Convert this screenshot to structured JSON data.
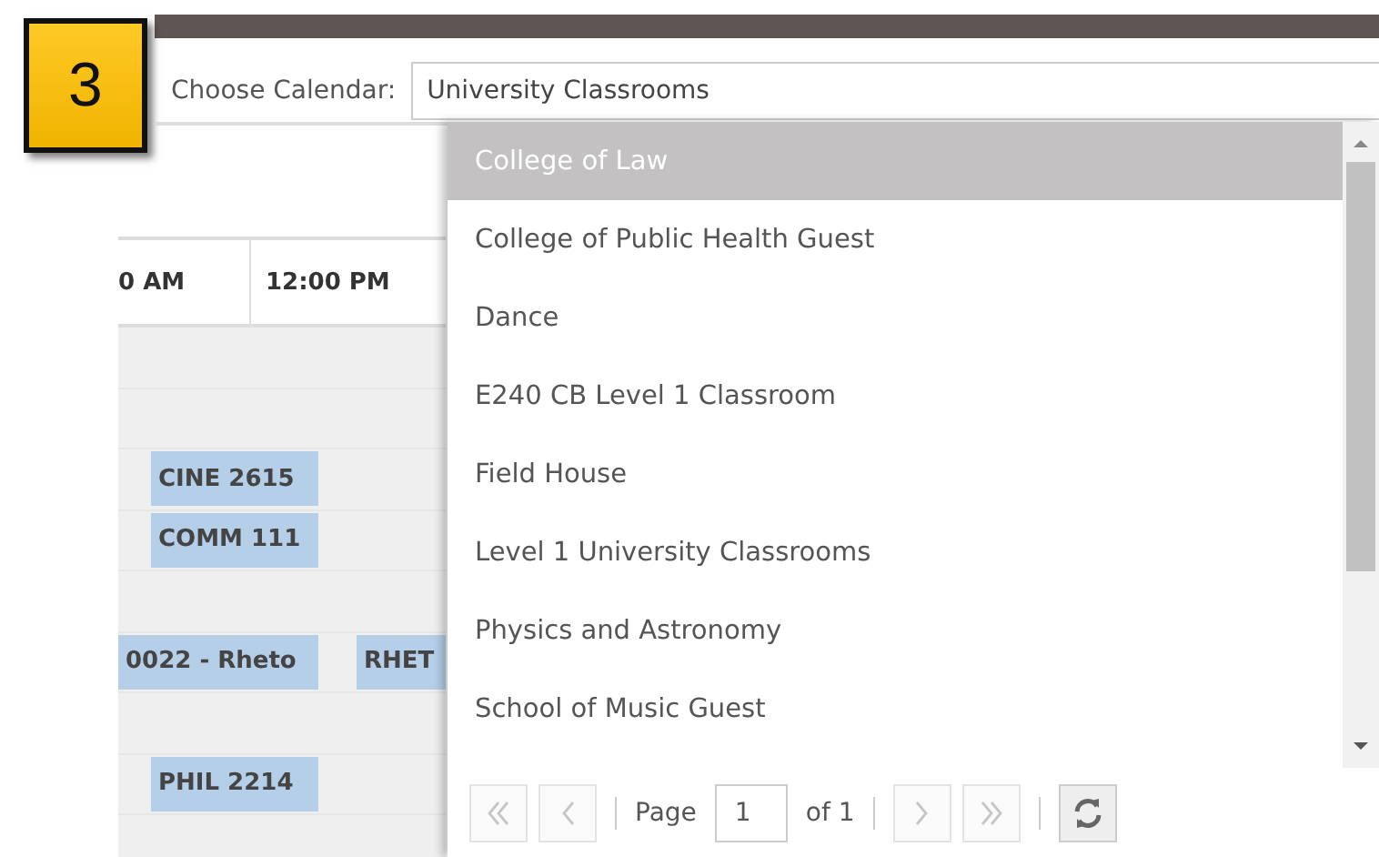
{
  "step_badge": "3",
  "calendar_picker": {
    "label": "Choose Calendar:",
    "value": "University Classrooms"
  },
  "dropdown": {
    "items": [
      {
        "label": "College of Law",
        "selected": true
      },
      {
        "label": "College of Public Health Guest",
        "selected": false
      },
      {
        "label": "Dance",
        "selected": false
      },
      {
        "label": "E240 CB Level 1 Classroom",
        "selected": false
      },
      {
        "label": "Field House",
        "selected": false
      },
      {
        "label": "Level 1 University Classrooms",
        "selected": false
      },
      {
        "label": "Physics and Astronomy",
        "selected": false
      },
      {
        "label": "School of Music Guest",
        "selected": false
      }
    ],
    "pager": {
      "buttons": [
        {
          "kind": "first",
          "disabled": true
        },
        {
          "kind": "prev",
          "disabled": true
        },
        {
          "kind": "next",
          "disabled": true
        },
        {
          "kind": "last",
          "disabled": true
        },
        {
          "kind": "refresh",
          "disabled": false
        }
      ],
      "label": "Page",
      "page": "1",
      "total": "of 1"
    }
  },
  "calendar": {
    "columns": [
      "0 AM",
      "12:00 PM"
    ],
    "events": [
      "CINE 2615",
      "COMM 111",
      "0022 - Rheto",
      "RHET",
      "PHIL 2214"
    ]
  }
}
